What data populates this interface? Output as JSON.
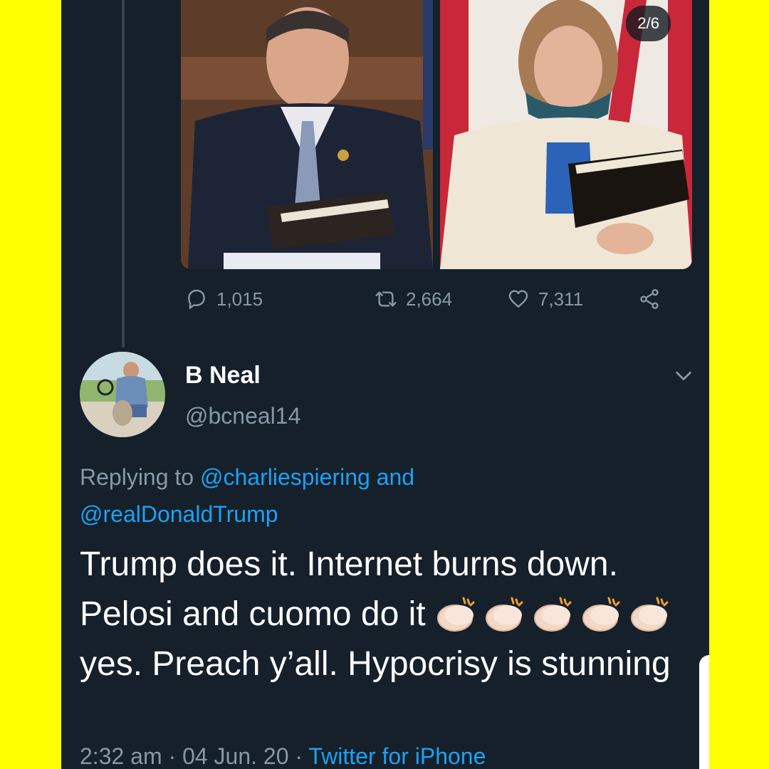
{
  "gallery": {
    "counter": "2/6"
  },
  "actions": {
    "replies": "1,015",
    "retweets": "2,664",
    "likes": "7,311"
  },
  "user": {
    "display_name": "B Neal",
    "handle": "@bcneal14"
  },
  "reply": {
    "prefix": "Replying to",
    "mention1": "@charliespiering",
    "joiner": "and",
    "mention2": "@realDonaldTrump"
  },
  "tweet": {
    "line1": "Trump does it. Internet burns down. Pelosi and cuomo do it",
    "line2": "yes. Preach y’all. Hypocrisy is stunning"
  },
  "meta": {
    "time": "2:32 am",
    "date": "04 Jun. 20",
    "source": "Twitter for iPhone"
  },
  "colors": {
    "background": "#15202b",
    "frame": "#ffff00",
    "accent": "#1da1f2",
    "muted": "#8899a6"
  }
}
